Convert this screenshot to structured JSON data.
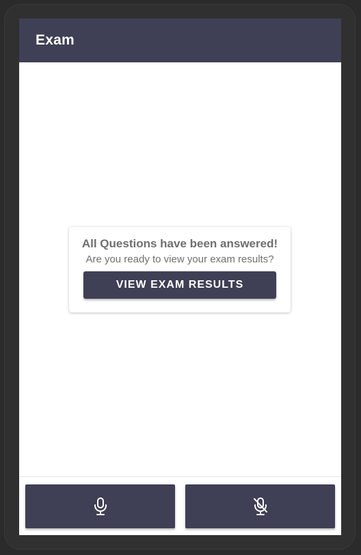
{
  "app_bar": {
    "title": "Exam"
  },
  "completion_card": {
    "heading": "All Questions have been answered!",
    "subtext": "Are you ready to view your exam results?",
    "button_label": "VIEW EXAM RESULTS"
  },
  "bottom_bar": {
    "buttons": [
      {
        "icon": "microphone-icon"
      },
      {
        "icon": "microphone-off-icon"
      }
    ]
  },
  "colors": {
    "primary": "#3f3f55",
    "frame": "#2b2b2b",
    "text_gray": "#6f6f6f",
    "background": "#ffffff"
  }
}
